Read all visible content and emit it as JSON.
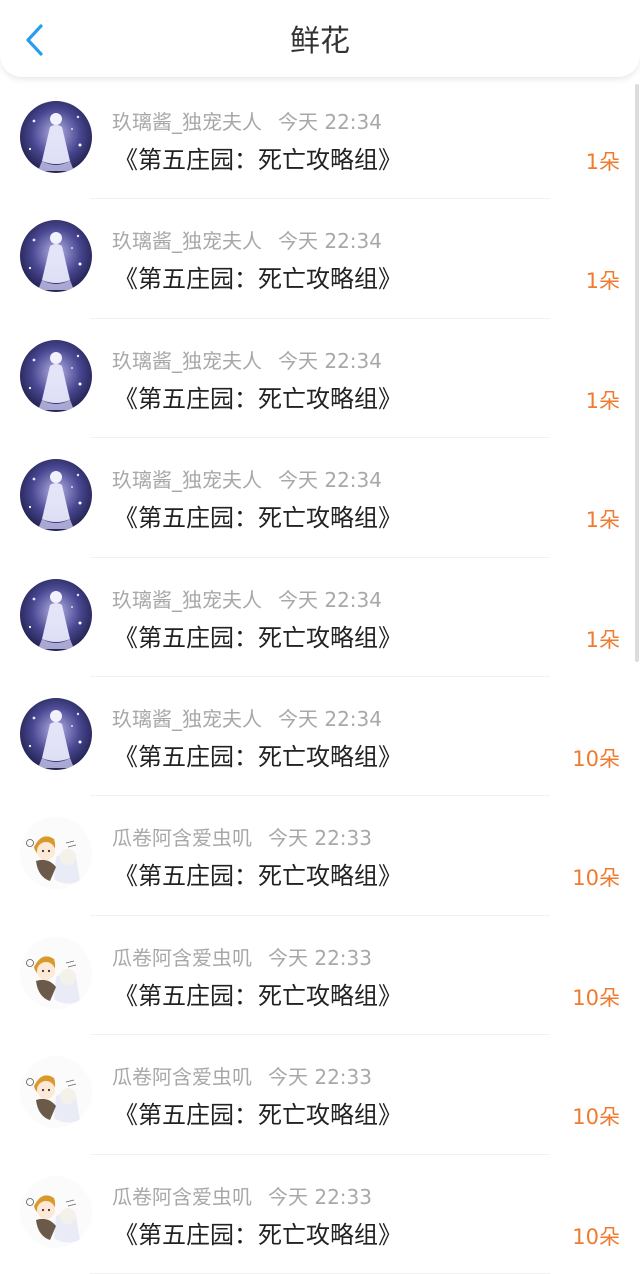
{
  "header": {
    "title": "鲜花"
  },
  "colors": {
    "accent": "#2a9cf0",
    "count": "#f07b2f",
    "meta": "#a8a8a8"
  },
  "rows": [
    {
      "user": "玖璃酱_独宠夫人",
      "time": "今天 22:34",
      "book": "《第五庄园：死亡攻略组》",
      "count": "1朵",
      "avatar": "night-girl"
    },
    {
      "user": "玖璃酱_独宠夫人",
      "time": "今天 22:34",
      "book": "《第五庄园：死亡攻略组》",
      "count": "1朵",
      "avatar": "night-girl"
    },
    {
      "user": "玖璃酱_独宠夫人",
      "time": "今天 22:34",
      "book": "《第五庄园：死亡攻略组》",
      "count": "1朵",
      "avatar": "night-girl"
    },
    {
      "user": "玖璃酱_独宠夫人",
      "time": "今天 22:34",
      "book": "《第五庄园：死亡攻略组》",
      "count": "1朵",
      "avatar": "night-girl"
    },
    {
      "user": "玖璃酱_独宠夫人",
      "time": "今天 22:34",
      "book": "《第五庄园：死亡攻略组》",
      "count": "1朵",
      "avatar": "night-girl"
    },
    {
      "user": "玖璃酱_独宠夫人",
      "time": "今天 22:34",
      "book": "《第五庄园：死亡攻略组》",
      "count": "10朵",
      "avatar": "night-girl"
    },
    {
      "user": "瓜卷阿含爱虫叽",
      "time": "今天 22:33",
      "book": "《第五庄园：死亡攻略组》",
      "count": "10朵",
      "avatar": "chibi-pair"
    },
    {
      "user": "瓜卷阿含爱虫叽",
      "time": "今天 22:33",
      "book": "《第五庄园：死亡攻略组》",
      "count": "10朵",
      "avatar": "chibi-pair"
    },
    {
      "user": "瓜卷阿含爱虫叽",
      "time": "今天 22:33",
      "book": "《第五庄园：死亡攻略组》",
      "count": "10朵",
      "avatar": "chibi-pair"
    },
    {
      "user": "瓜卷阿含爱虫叽",
      "time": "今天 22:33",
      "book": "《第五庄园：死亡攻略组》",
      "count": "10朵",
      "avatar": "chibi-pair"
    }
  ]
}
